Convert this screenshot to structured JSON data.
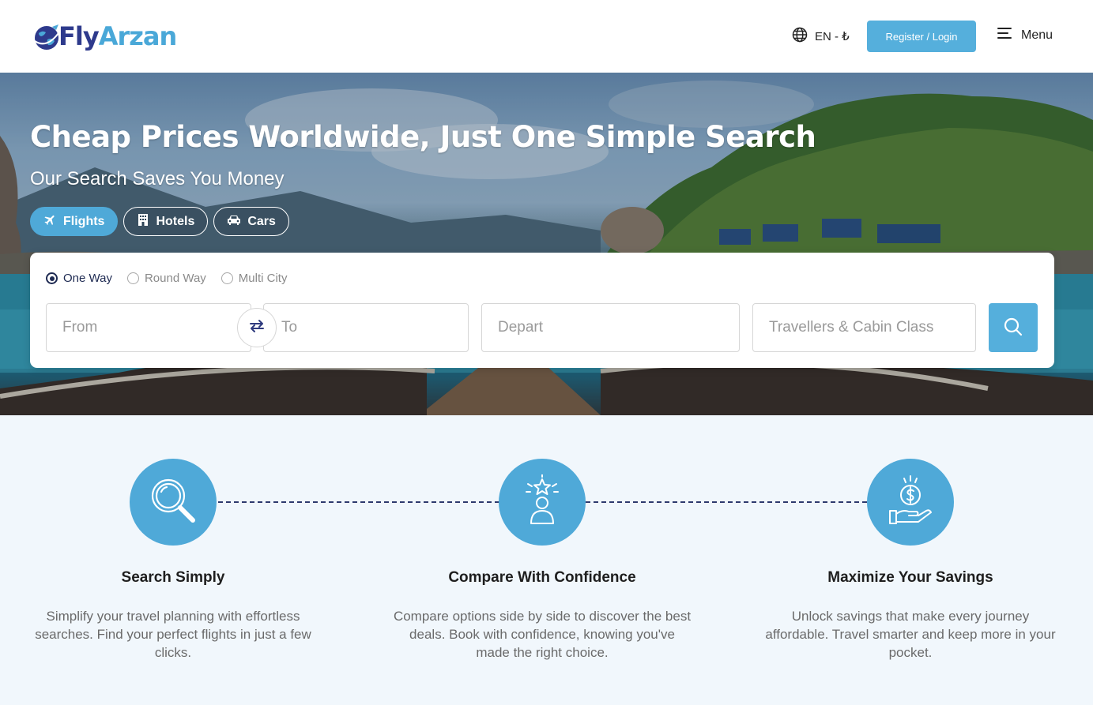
{
  "header": {
    "logo": {
      "part1": "Fly",
      "part2": "Arzan"
    },
    "language": "EN - ₺",
    "register_login": "Register / Login",
    "menu": "Menu"
  },
  "hero": {
    "title": "Cheap Prices Worldwide, Just One Simple Search",
    "subtitle": "Our Search Saves You Money",
    "tabs": [
      {
        "label": "Flights",
        "icon": "plane-icon",
        "active": true
      },
      {
        "label": "Hotels",
        "icon": "hotel-icon",
        "active": false
      },
      {
        "label": "Cars",
        "icon": "car-icon",
        "active": false
      }
    ]
  },
  "search": {
    "trip_types": [
      {
        "label": "One Way",
        "checked": true
      },
      {
        "label": "Round Way",
        "checked": false
      },
      {
        "label": "Multi City",
        "checked": false
      }
    ],
    "from_placeholder": "From",
    "to_placeholder": "To",
    "depart_placeholder": "Depart",
    "travellers_placeholder": "Travellers & Cabin Class"
  },
  "features": [
    {
      "icon": "magnifier-icon",
      "title": "Search Simply",
      "description": "Simplify your travel planning with effortless searches. Find your perfect flights in just a few clicks."
    },
    {
      "icon": "star-person-icon",
      "title": "Compare With Confidence",
      "description": "Compare options side by side to discover the best deals. Book with confidence, knowing you've made the right choice."
    },
    {
      "icon": "money-hand-icon",
      "title": "Maximize Your Savings",
      "description": "Unlock savings that make every journey affordable. Travel smarter and keep more in your pocket."
    }
  ],
  "colors": {
    "accent": "#55afdc",
    "brand_dark": "#2e3a8c",
    "feature_bg": "#f1f7fc"
  }
}
